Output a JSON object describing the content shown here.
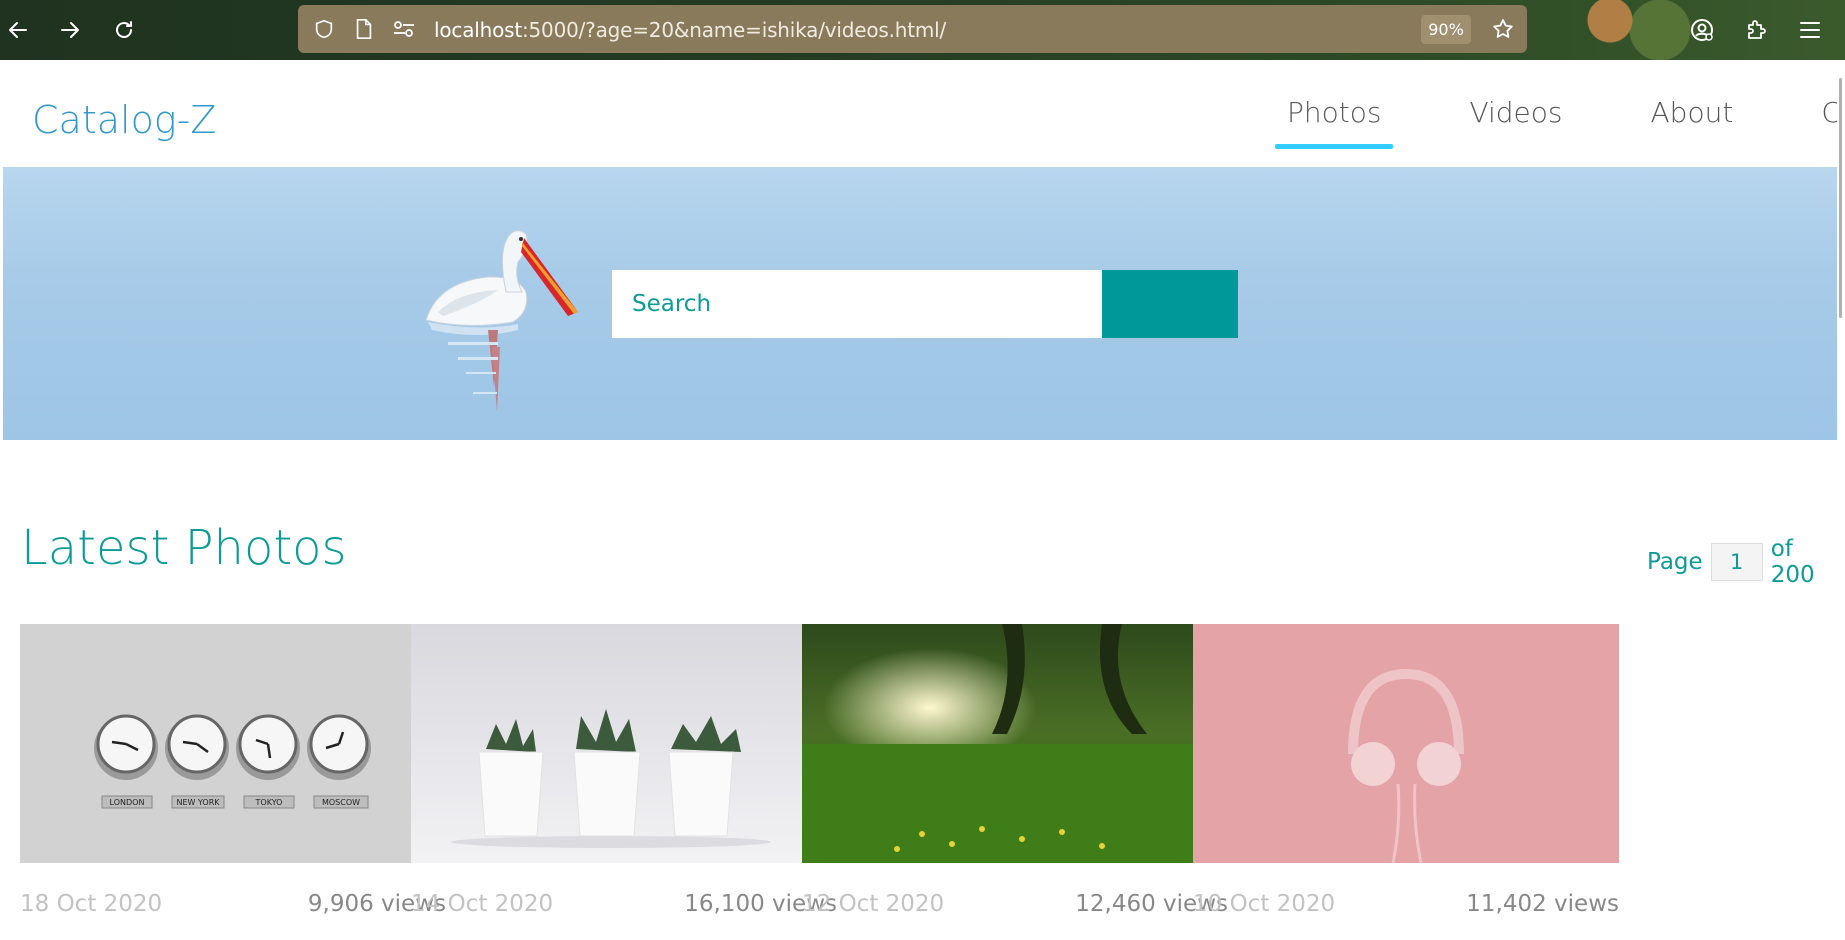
{
  "browser": {
    "url_host": "localhost",
    "url_rest": ":5000/?age=20&name=ishika/videos.html/",
    "zoom": "90%",
    "icons": [
      "back-arrow-icon",
      "forward-arrow-icon",
      "reload-icon",
      "shield-icon",
      "page-icon",
      "site-settings-icon",
      "bookmark-star-icon",
      "account-icon",
      "extensions-icon",
      "menu-icon"
    ]
  },
  "header": {
    "brand": "Catalog-Z",
    "nav": [
      {
        "label": "Photos",
        "active": true
      },
      {
        "label": "Videos",
        "active": false
      },
      {
        "label": "About",
        "active": false
      },
      {
        "label": "Contact",
        "active": false
      }
    ]
  },
  "hero": {
    "search_placeholder": "Search"
  },
  "gallery": {
    "title": "Latest Photos",
    "pager": {
      "prefix": "Page",
      "current": "1",
      "suffix": "of 200"
    },
    "items": [
      {
        "date": "18 Oct 2020",
        "views": "9,906 views",
        "image": "world-clocks",
        "clock_labels": [
          "LONDON",
          "NEW YORK",
          "TOKYO",
          "MOSCOW"
        ]
      },
      {
        "date": "14 Oct 2020",
        "views": "16,100 views",
        "image": "potted-succulents"
      },
      {
        "date": "12 Oct 2020",
        "views": "12,460 views",
        "image": "sunlit-meadow"
      },
      {
        "date": "10 Oct 2020",
        "views": "11,402 views",
        "image": "pink-headphones"
      }
    ]
  },
  "colors": {
    "brand": "#3399cc",
    "accent": "#009999",
    "nav_underline": "#33ccff"
  }
}
